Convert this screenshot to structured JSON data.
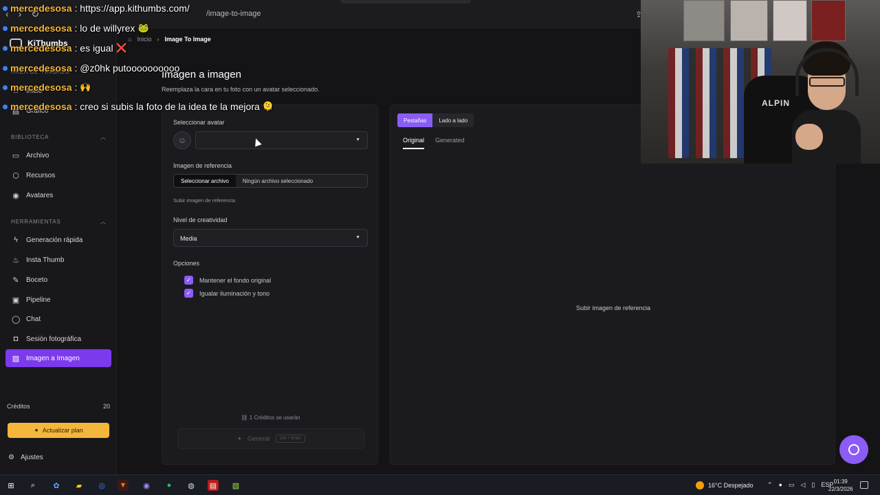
{
  "browser": {
    "url_fragment": "/image-to-image"
  },
  "app": {
    "brand": "KiThumbs",
    "breadcrumb": {
      "home": "Inicio",
      "sep": "›",
      "current": "Image To Image"
    }
  },
  "sidebar": {
    "sections": [
      {
        "label": "Área de trabajo"
      },
      {
        "label": "Biblioteca"
      },
      {
        "label": "Herramientas"
      }
    ],
    "items": [
      {
        "label": "Inicio",
        "icon": "home-icon",
        "glyph": "⌂"
      },
      {
        "label": "Gráfico",
        "icon": "chart-icon",
        "glyph": "▤"
      },
      {
        "label": "Archivo",
        "icon": "archive-icon",
        "glyph": "▭"
      },
      {
        "label": "Recursos",
        "icon": "resources-icon",
        "glyph": "⬡"
      },
      {
        "label": "Avatares",
        "icon": "avatar-icon",
        "glyph": "◉"
      },
      {
        "label": "Generación rápida",
        "icon": "lightning-icon",
        "glyph": "ϟ"
      },
      {
        "label": "Insta Thumb",
        "icon": "flame-icon",
        "glyph": "♨"
      },
      {
        "label": "Boceto",
        "icon": "pencil-icon",
        "glyph": "✎"
      },
      {
        "label": "Pipeline",
        "icon": "pipeline-icon",
        "glyph": "▣"
      },
      {
        "label": "Chat",
        "icon": "chat-icon",
        "glyph": "◯"
      },
      {
        "label": "Sesión fotográfica",
        "icon": "camera-icon",
        "glyph": "◘"
      },
      {
        "label": "Imagen a Imagen",
        "icon": "image-icon",
        "glyph": "▨"
      }
    ],
    "credits_label": "Créditos",
    "credits_value": "20",
    "upgrade_label": "Actualizar plan",
    "settings_label": "Ajustes"
  },
  "page": {
    "title": "Imagen a imagen",
    "subtitle": "Reemplaza la cara en tu foto con un avatar seleccionado."
  },
  "form": {
    "avatar_label": "Seleccionar avatar",
    "avatar_value": "",
    "reference_label": "Imagen de referencia",
    "file_button": "Seleccionar archivo",
    "file_status": "Ningún archivo seleccionado",
    "reference_hint": "Subir imagen de referencia",
    "creativity_label": "Nivel de creatividad",
    "creativity_value": "Media",
    "options_label": "Opciones",
    "options": [
      {
        "label": "Mantener el fondo original",
        "checked": true
      },
      {
        "label": "Igualar iluminación y tono",
        "checked": true
      }
    ],
    "cost_text": "1 Créditos se usarán",
    "generate_label": "Generar",
    "generate_shortcut": "Ctrl + Enter"
  },
  "preview": {
    "view_modes": [
      "Pestañas",
      "Lado a lado"
    ],
    "tabs": [
      "Original",
      "Generated"
    ],
    "placeholder": "Subir imagen de referencia"
  },
  "chat_overlay": [
    {
      "user": "mercedesosa",
      "message": ": https://app.kithumbs.com/",
      "emote": ""
    },
    {
      "user": "mercedesosa",
      "message": ": lo de willyrex",
      "emote": "🐸"
    },
    {
      "user": "mercedesosa",
      "message": ": es igual",
      "emote": "❌"
    },
    {
      "user": "mercedesosa",
      "message": ": @z0hk putoooooooooo",
      "emote": ""
    },
    {
      "user": "mercedesosa",
      "message": ":",
      "emote": "🙌"
    },
    {
      "user": "mercedesosa",
      "message": ": creo si subis la foto de la idea te la mejora",
      "emote": "🫠"
    }
  ],
  "webcam": {
    "chair_text": "ALPIN"
  },
  "taskbar": {
    "weather": "16°C Despejado",
    "lang": "ESP",
    "time": "01:39",
    "date": "22/3/2026"
  },
  "colors": {
    "accent": "#8b5cf6",
    "active_nav": "#7c3aed",
    "upgrade": "#f5b73b",
    "chat_user": "#f5b73b"
  }
}
